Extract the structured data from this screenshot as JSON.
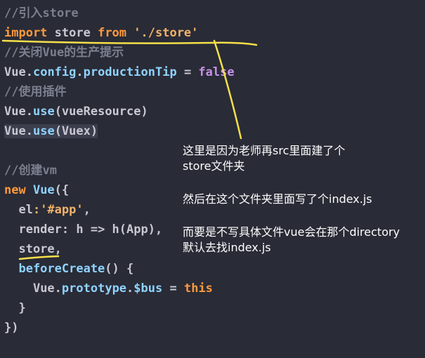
{
  "code": {
    "line1_comment": "//引入store",
    "line2": {
      "kw_import": "import",
      "ident": " store ",
      "kw_from": "from",
      "space": " ",
      "path": "'./store'"
    },
    "line3_comment": "//关闭Vue的生产提示",
    "line4": {
      "obj": "Vue",
      "dot1": ".",
      "config": "config",
      "dot2": ".",
      "prop": "productionTip",
      "eq": " = ",
      "val": "false"
    },
    "line5_comment": "//使用插件",
    "line6": {
      "obj": "Vue",
      "dot": ".",
      "method": "use",
      "arg": "(vueResource)"
    },
    "line7": {
      "obj": "Vue",
      "dot": ".",
      "method": "use",
      "arg": "(Vuex)"
    },
    "line8_comment": "//创建vm",
    "line9": {
      "kw_new": "new",
      "ctor": " Vue",
      "open": "({"
    },
    "line10": {
      "key": "  el",
      "rest": ":'#app'",
      "comma": ","
    },
    "line11": {
      "key": "  render",
      "rest": ": h => h(App)",
      "comma": ","
    },
    "line12": {
      "key": "  store",
      "comma": ","
    },
    "line13": {
      "fn": "  beforeCreate",
      "rest": "() {"
    },
    "line14": {
      "indent": "    ",
      "obj": "Vue",
      "dot1": ".",
      "proto": "prototype",
      "dot2": ".",
      "prop": "$bus",
      "eq": " = ",
      "kw": "this"
    },
    "line15": "  }",
    "line16": "})"
  },
  "annotations": {
    "note1_line1": "这里是因为老师再src里面建了个",
    "note1_line2": "store文件夹",
    "note2": "然后在这个文件夹里面写了个index.js",
    "note3_line1": "而要是不写具体文件vue会在那个directory",
    "note3_line2": "默认去找index.js"
  },
  "colors": {
    "background": "#292b36",
    "keyword": "#ff9a3c",
    "comment": "#7b7f8e",
    "function": "#8fd3ff",
    "string": "#f0b26a",
    "annotation_marker": "#f6e04a"
  }
}
